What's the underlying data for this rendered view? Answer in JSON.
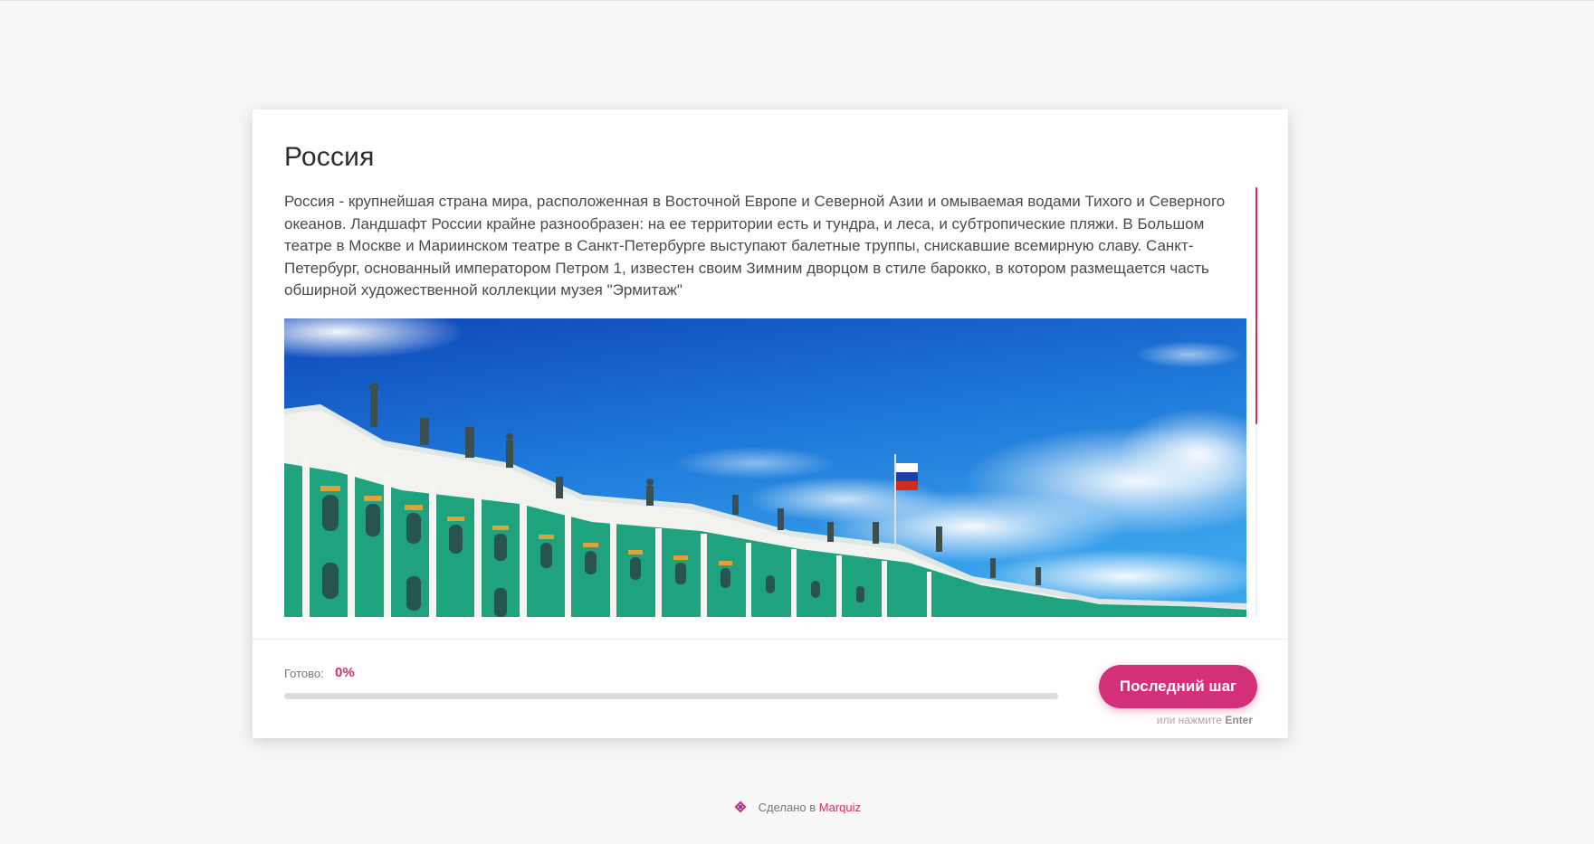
{
  "quiz": {
    "title": "Россия",
    "description": "Россия - крупнейшая страна мира, расположенная в Восточной Европе и Северной Азии и омываемая водами Тихого и Северного океанов. Ландшафт России крайне разнообразен: на ее территории есть и тундра, и леса, и субтропические пляжи. В Большом театре в Москве и Мариинском театре в Санкт-Петербурге выступают балетные труппы, снискавшие всемирную славу. Санкт-Петербург, основанный императором Петром 1, известен своим Зимним дворцом в стиле барокко, в котором размещается часть обширной художественной коллекции музея \"Эрмитаж\""
  },
  "progress": {
    "label": "Готово:",
    "value_text": "0%",
    "value": 0
  },
  "actions": {
    "next_label": "Последний шаг",
    "hint_prefix": "или нажмите",
    "hint_key": "Enter"
  },
  "footer": {
    "made_in": "Сделано в",
    "brand": "Marquiz"
  },
  "colors": {
    "accent": "#d4307a",
    "background": "#f7f7f7",
    "card": "#ffffff"
  },
  "icons": {
    "footer_logo": "marquiz-logo-icon"
  }
}
